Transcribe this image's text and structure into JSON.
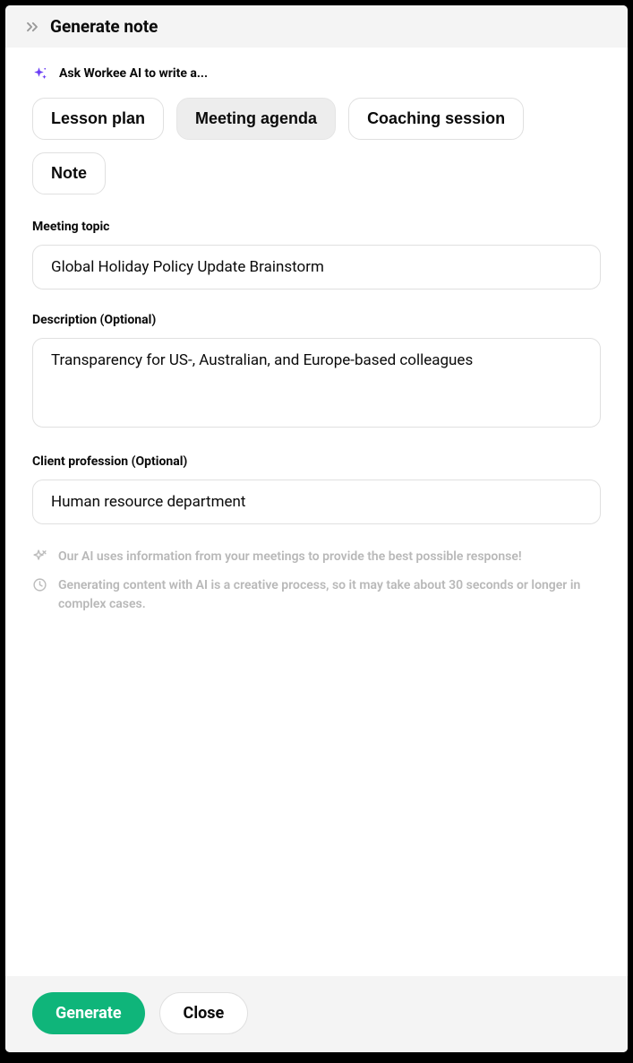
{
  "header": {
    "title": "Generate note"
  },
  "prompt": "Ask Workee AI to write a...",
  "pills": [
    {
      "label": "Lesson plan",
      "selected": false
    },
    {
      "label": "Meeting agenda",
      "selected": true
    },
    {
      "label": "Coaching session",
      "selected": false
    },
    {
      "label": "Note",
      "selected": false
    }
  ],
  "fields": {
    "topic": {
      "label": "Meeting topic",
      "value": "Global Holiday Policy Update Brainstorm"
    },
    "description": {
      "label": "Description (Optional)",
      "value": "Transparency for US-, Australian, and Europe-based colleagues"
    },
    "profession": {
      "label": "Client profession (Optional)",
      "value": "Human resource department"
    }
  },
  "info": {
    "line1": "Our AI uses information from your meetings to provide the best possible response!",
    "line2": "Generating content with AI is a creative process, so it may take about 30 seconds or longer in complex cases."
  },
  "footer": {
    "generate": "Generate",
    "close": "Close"
  },
  "colors": {
    "accent": "#6a3ef5",
    "primary_button": "#0fb57a"
  }
}
